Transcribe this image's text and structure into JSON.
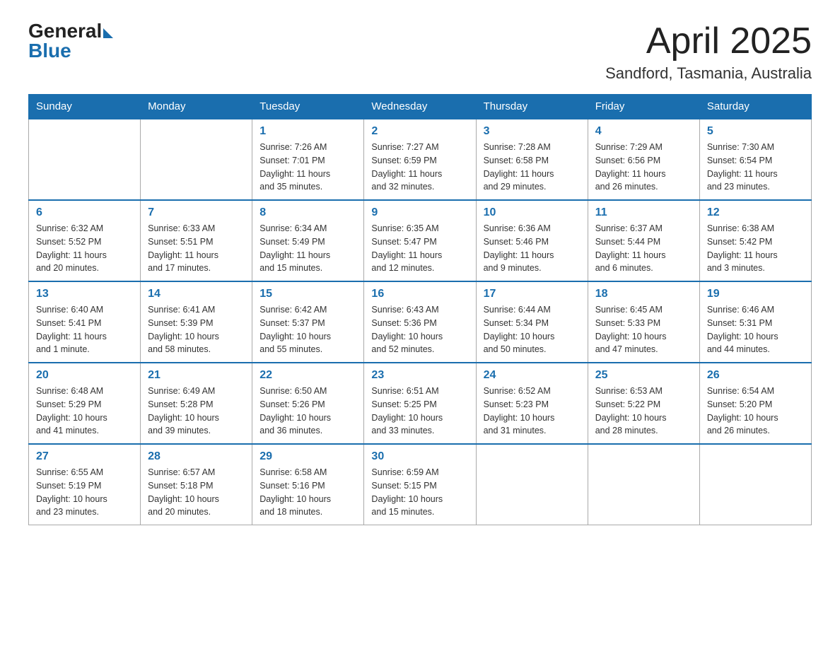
{
  "logo": {
    "general": "General",
    "blue": "Blue"
  },
  "title": {
    "month_year": "April 2025",
    "location": "Sandford, Tasmania, Australia"
  },
  "headers": [
    "Sunday",
    "Monday",
    "Tuesday",
    "Wednesday",
    "Thursday",
    "Friday",
    "Saturday"
  ],
  "weeks": [
    [
      {
        "day": "",
        "info": ""
      },
      {
        "day": "",
        "info": ""
      },
      {
        "day": "1",
        "info": "Sunrise: 7:26 AM\nSunset: 7:01 PM\nDaylight: 11 hours\nand 35 minutes."
      },
      {
        "day": "2",
        "info": "Sunrise: 7:27 AM\nSunset: 6:59 PM\nDaylight: 11 hours\nand 32 minutes."
      },
      {
        "day": "3",
        "info": "Sunrise: 7:28 AM\nSunset: 6:58 PM\nDaylight: 11 hours\nand 29 minutes."
      },
      {
        "day": "4",
        "info": "Sunrise: 7:29 AM\nSunset: 6:56 PM\nDaylight: 11 hours\nand 26 minutes."
      },
      {
        "day": "5",
        "info": "Sunrise: 7:30 AM\nSunset: 6:54 PM\nDaylight: 11 hours\nand 23 minutes."
      }
    ],
    [
      {
        "day": "6",
        "info": "Sunrise: 6:32 AM\nSunset: 5:52 PM\nDaylight: 11 hours\nand 20 minutes."
      },
      {
        "day": "7",
        "info": "Sunrise: 6:33 AM\nSunset: 5:51 PM\nDaylight: 11 hours\nand 17 minutes."
      },
      {
        "day": "8",
        "info": "Sunrise: 6:34 AM\nSunset: 5:49 PM\nDaylight: 11 hours\nand 15 minutes."
      },
      {
        "day": "9",
        "info": "Sunrise: 6:35 AM\nSunset: 5:47 PM\nDaylight: 11 hours\nand 12 minutes."
      },
      {
        "day": "10",
        "info": "Sunrise: 6:36 AM\nSunset: 5:46 PM\nDaylight: 11 hours\nand 9 minutes."
      },
      {
        "day": "11",
        "info": "Sunrise: 6:37 AM\nSunset: 5:44 PM\nDaylight: 11 hours\nand 6 minutes."
      },
      {
        "day": "12",
        "info": "Sunrise: 6:38 AM\nSunset: 5:42 PM\nDaylight: 11 hours\nand 3 minutes."
      }
    ],
    [
      {
        "day": "13",
        "info": "Sunrise: 6:40 AM\nSunset: 5:41 PM\nDaylight: 11 hours\nand 1 minute."
      },
      {
        "day": "14",
        "info": "Sunrise: 6:41 AM\nSunset: 5:39 PM\nDaylight: 10 hours\nand 58 minutes."
      },
      {
        "day": "15",
        "info": "Sunrise: 6:42 AM\nSunset: 5:37 PM\nDaylight: 10 hours\nand 55 minutes."
      },
      {
        "day": "16",
        "info": "Sunrise: 6:43 AM\nSunset: 5:36 PM\nDaylight: 10 hours\nand 52 minutes."
      },
      {
        "day": "17",
        "info": "Sunrise: 6:44 AM\nSunset: 5:34 PM\nDaylight: 10 hours\nand 50 minutes."
      },
      {
        "day": "18",
        "info": "Sunrise: 6:45 AM\nSunset: 5:33 PM\nDaylight: 10 hours\nand 47 minutes."
      },
      {
        "day": "19",
        "info": "Sunrise: 6:46 AM\nSunset: 5:31 PM\nDaylight: 10 hours\nand 44 minutes."
      }
    ],
    [
      {
        "day": "20",
        "info": "Sunrise: 6:48 AM\nSunset: 5:29 PM\nDaylight: 10 hours\nand 41 minutes."
      },
      {
        "day": "21",
        "info": "Sunrise: 6:49 AM\nSunset: 5:28 PM\nDaylight: 10 hours\nand 39 minutes."
      },
      {
        "day": "22",
        "info": "Sunrise: 6:50 AM\nSunset: 5:26 PM\nDaylight: 10 hours\nand 36 minutes."
      },
      {
        "day": "23",
        "info": "Sunrise: 6:51 AM\nSunset: 5:25 PM\nDaylight: 10 hours\nand 33 minutes."
      },
      {
        "day": "24",
        "info": "Sunrise: 6:52 AM\nSunset: 5:23 PM\nDaylight: 10 hours\nand 31 minutes."
      },
      {
        "day": "25",
        "info": "Sunrise: 6:53 AM\nSunset: 5:22 PM\nDaylight: 10 hours\nand 28 minutes."
      },
      {
        "day": "26",
        "info": "Sunrise: 6:54 AM\nSunset: 5:20 PM\nDaylight: 10 hours\nand 26 minutes."
      }
    ],
    [
      {
        "day": "27",
        "info": "Sunrise: 6:55 AM\nSunset: 5:19 PM\nDaylight: 10 hours\nand 23 minutes."
      },
      {
        "day": "28",
        "info": "Sunrise: 6:57 AM\nSunset: 5:18 PM\nDaylight: 10 hours\nand 20 minutes."
      },
      {
        "day": "29",
        "info": "Sunrise: 6:58 AM\nSunset: 5:16 PM\nDaylight: 10 hours\nand 18 minutes."
      },
      {
        "day": "30",
        "info": "Sunrise: 6:59 AM\nSunset: 5:15 PM\nDaylight: 10 hours\nand 15 minutes."
      },
      {
        "day": "",
        "info": ""
      },
      {
        "day": "",
        "info": ""
      },
      {
        "day": "",
        "info": ""
      }
    ]
  ]
}
